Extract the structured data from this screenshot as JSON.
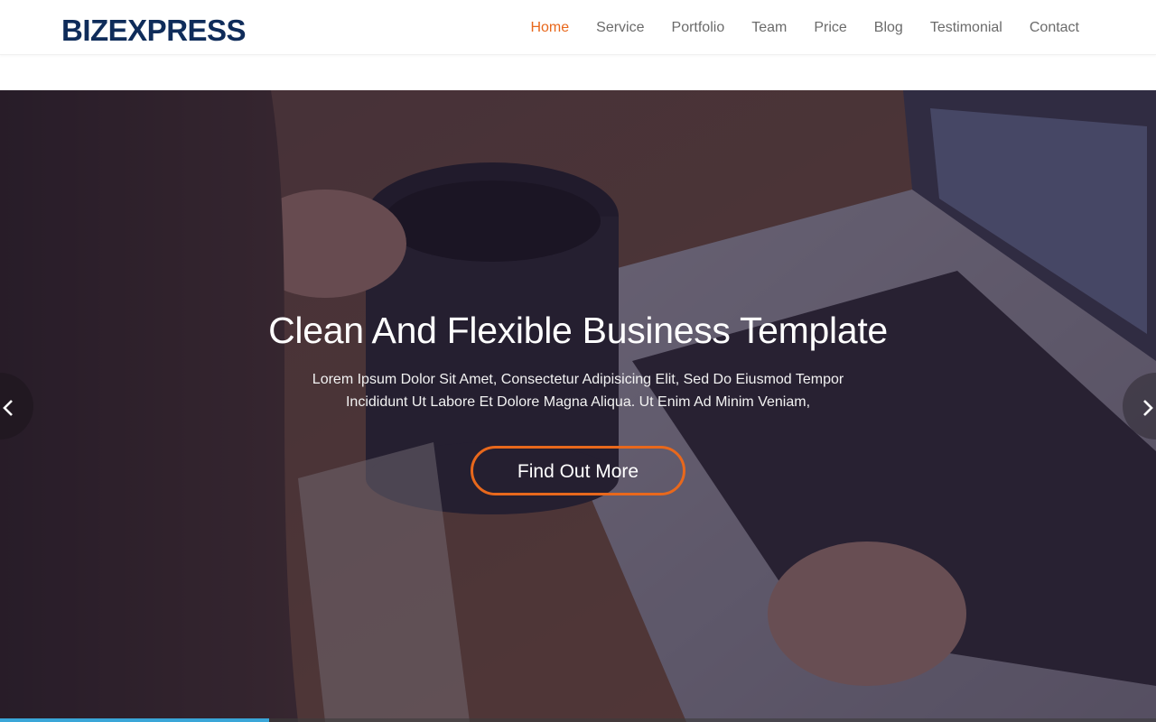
{
  "header": {
    "brand": "BIZEXPRESS",
    "nav": [
      {
        "label": "Home",
        "active": true
      },
      {
        "label": "Service",
        "active": false
      },
      {
        "label": "Portfolio",
        "active": false
      },
      {
        "label": "Team",
        "active": false
      },
      {
        "label": "Price",
        "active": false
      },
      {
        "label": "Blog",
        "active": false
      },
      {
        "label": "Testimonial",
        "active": false
      },
      {
        "label": "Contact",
        "active": false
      }
    ]
  },
  "hero": {
    "title": "Clean And Flexible Business Template",
    "text": "Lorem Ipsum Dolor Sit Amet, Consectetur Adipisicing Elit, Sed Do Eiusmod Tempor Incididunt Ut Labore Et Dolore Magna Aliqua. Ut Enim Ad Minim Veniam,",
    "cta_label": "Find Out More",
    "prev_icon": "chevron-left-icon",
    "next_icon": "chevron-right-icon",
    "slide_progress": 0.233
  },
  "colors": {
    "brand": "#0f2c5a",
    "accent": "#e8681c",
    "progress": "#3aa6d8"
  }
}
